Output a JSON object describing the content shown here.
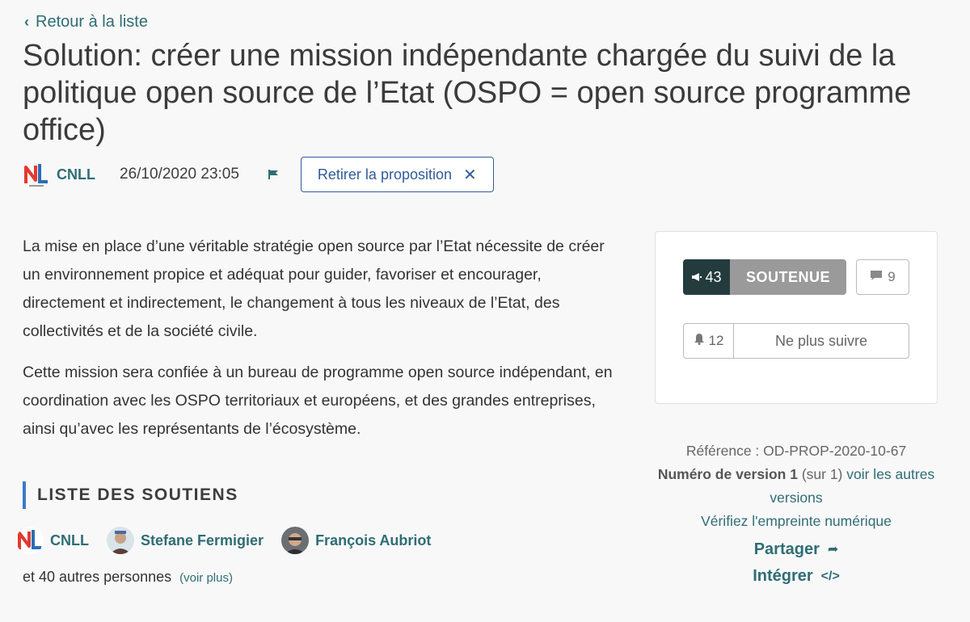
{
  "nav": {
    "back_label": "Retour à la liste"
  },
  "proposal": {
    "title": "Solution: créer une mission indépendante chargée du suivi de la politique open source de l’Etat (OSPO = open source programme office)",
    "author": "CNLL",
    "date": "26/10/2020 23:05",
    "withdraw_label": "Retirer la proposition",
    "paragraphs": [
      "La mise en place d’une véritable stratégie open source par l’Etat nécessite de créer un environnement propice et adéquat pour guider, favoriser et encourager, directement et indirectement, le changement à tous les niveaux de l’Etat, des collectivités et de la société civile.",
      "Cette mission sera confiée à un bureau de programme open source indépendant, en coordination avec les OSPO territoriaux et européens, et des grandes entreprises, ainsi qu’avec les représentants de l’écosystème."
    ]
  },
  "supporters_section": {
    "title": "LISTE DES SOUTIENS",
    "supporters": [
      {
        "name": "CNLL"
      },
      {
        "name": "Stefane Fermigier"
      },
      {
        "name": "François Aubriot"
      }
    ],
    "others_text": "et 40 autres personnes",
    "see_more": "(voir plus)"
  },
  "panel": {
    "vote_count": "43",
    "vote_label": "SOUTENUE",
    "comments_count": "9",
    "followers_count": "12",
    "follow_label": "Ne plus suivre"
  },
  "info": {
    "reference": "Référence : OD-PROP-2020-10-67",
    "version_label": "Numéro de version 1",
    "version_total": "(sur 1)",
    "other_versions": "voir les autres versions",
    "fingerprint": "Vérifiez l'empreinte numérique",
    "share": "Partager",
    "embed": "Intégrer"
  },
  "colors": {
    "accent": "#2f6d75",
    "button_border": "#2f5c9a",
    "vote_dark": "#243b3e",
    "vote_gray": "#9a9a9a",
    "section_bar": "#3c79c9"
  },
  "icons": {
    "back": "chevron-left-icon",
    "flag": "flag-icon",
    "close": "close-icon",
    "megaphone": "megaphone-icon",
    "comment": "comment-icon",
    "bell": "bell-icon",
    "share": "share-arrow-icon",
    "embed": "code-icon"
  }
}
